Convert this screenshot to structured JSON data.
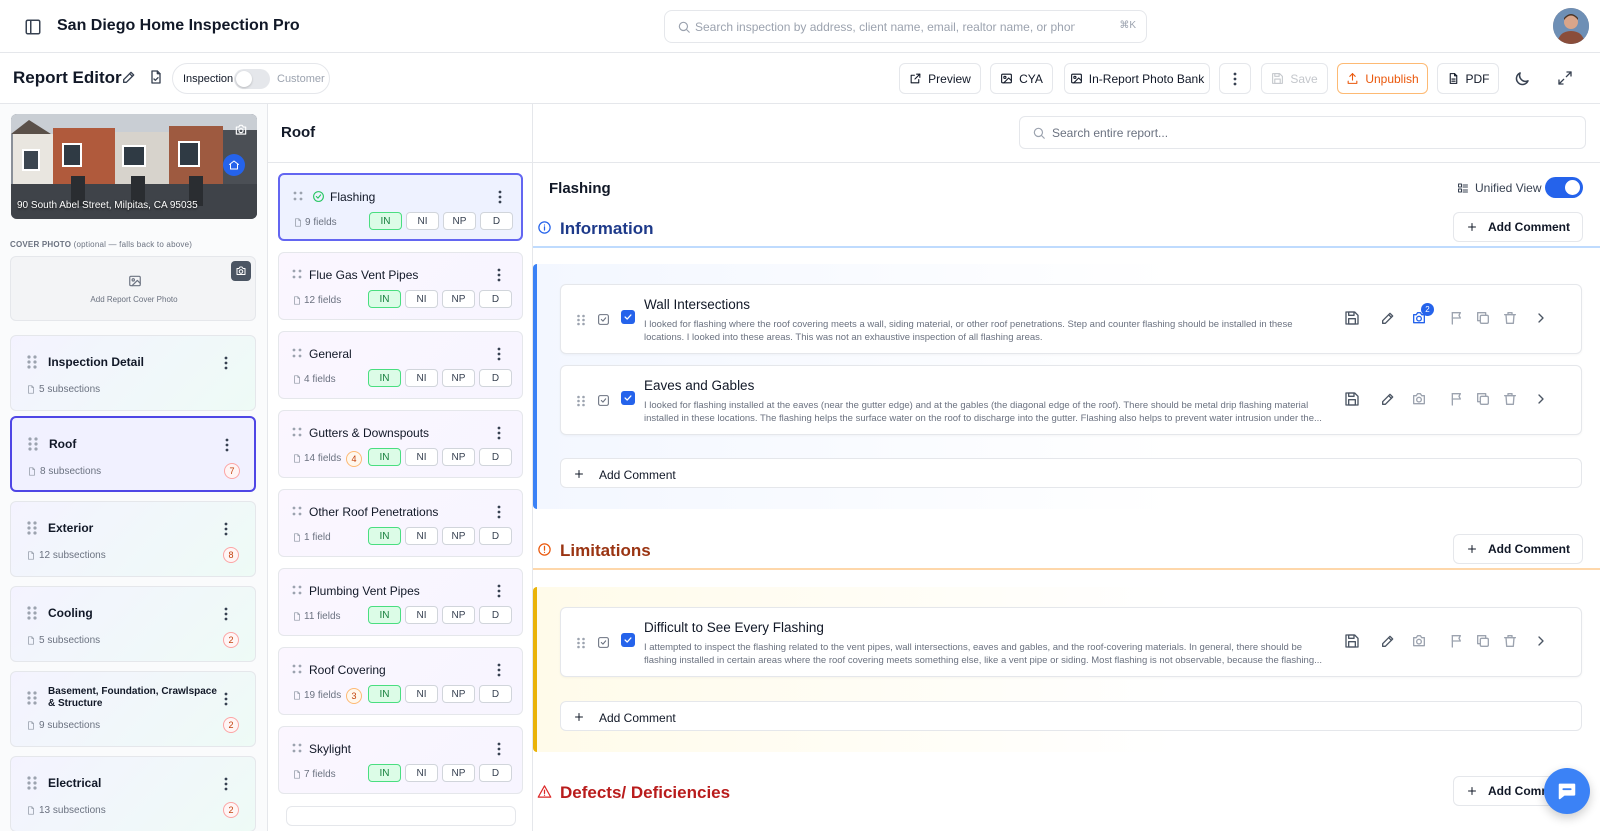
{
  "app": {
    "title": "San Diego Home Inspection Pro",
    "search_placeholder": "Search inspection by address, client name, email, realtor name, or phone...",
    "search_shortcut": "⌘K"
  },
  "editor": {
    "title": "Report Editor",
    "mode_left": "Inspection",
    "mode_right": "Customer",
    "buttons": {
      "preview": "Preview",
      "cya": "CYA",
      "photo_bank": "In-Report Photo Bank",
      "save": "Save",
      "unpublish": "Unpublish",
      "pdf": "PDF"
    }
  },
  "property": {
    "address": "90 South Abel Street, Milpitas, CA 95035",
    "cover_label_strong": "COVER PHOTO",
    "cover_label_note": "(optional — falls back to above)",
    "cover_add": "Add Report Cover Photo"
  },
  "sections": [
    {
      "name": "Inspection Detail",
      "subsections": "5 subsections",
      "badge": ""
    },
    {
      "name": "Roof",
      "subsections": "8 subsections",
      "badge": "7"
    },
    {
      "name": "Exterior",
      "subsections": "12 subsections",
      "badge": "8"
    },
    {
      "name": "Cooling",
      "subsections": "5 subsections",
      "badge": "2"
    },
    {
      "name": "Basement, Foundation, Crawlspace & Structure",
      "subsections": "9 subsections",
      "badge": "2"
    },
    {
      "name": "Electrical",
      "subsections": "13 subsections",
      "badge": "2"
    }
  ],
  "middle": {
    "title": "Roof",
    "status_pills": [
      "IN",
      "NI",
      "NP",
      "D"
    ],
    "subsections": [
      {
        "name": "Flashing",
        "fields": "9 fields",
        "badge": ""
      },
      {
        "name": "Flue Gas Vent Pipes",
        "fields": "12 fields",
        "badge": ""
      },
      {
        "name": "General",
        "fields": "4 fields",
        "badge": ""
      },
      {
        "name": "Gutters & Downspouts",
        "fields": "14 fields",
        "badge": "4"
      },
      {
        "name": "Other Roof Penetrations",
        "fields": "1 field",
        "badge": ""
      },
      {
        "name": "Plumbing Vent Pipes",
        "fields": "11 fields",
        "badge": ""
      },
      {
        "name": "Roof Covering",
        "fields": "19 fields",
        "badge": "3"
      },
      {
        "name": "Skylight",
        "fields": "7 fields",
        "badge": ""
      }
    ]
  },
  "right": {
    "search_placeholder": "Search entire report...",
    "subsection_title": "Flashing",
    "unified_view": "Unified View",
    "add_comment": "Add Comment",
    "categories": {
      "information": {
        "title": "Information",
        "color": "#1e3a8a",
        "comments": [
          {
            "title": "Wall Intersections",
            "body": "I looked for flashing where the roof covering meets a wall, siding material, or other roof penetrations. Step and counter flashing should be installed in these locations. I looked into these areas. This was not an exhaustive inspection of all flashing areas.",
            "photo_count": "2"
          },
          {
            "title": "Eaves and Gables",
            "body": "I looked for flashing installed at the eaves (near the gutter edge) and at the gables (the diagonal edge of the roof). There should be metal drip flashing material installed in these locations. The flashing helps the surface water on the roof to discharge into the gutter. Flashing also helps to prevent water intrusion under the..."
          }
        ]
      },
      "limitations": {
        "title": "Limitations",
        "color": "#9a3412",
        "comments": [
          {
            "title": "Difficult to See Every Flashing",
            "body": "I attempted to inspect the flashing related to the vent pipes, wall intersections, eaves and gables, and the roof-covering materials. In general, there should be flashing installed in certain areas where the roof covering meets something else, like a vent pipe or siding. Most flashing is not observable, because the flashing..."
          }
        ]
      },
      "defects": {
        "title": "Defects/ Deficiencies",
        "color": "#b91c1c"
      }
    }
  },
  "colors": {
    "accent": "#2563eb",
    "active_border": "#4f46e5",
    "unpublish": "#ea580c",
    "in_pill": "#dcfce7"
  }
}
